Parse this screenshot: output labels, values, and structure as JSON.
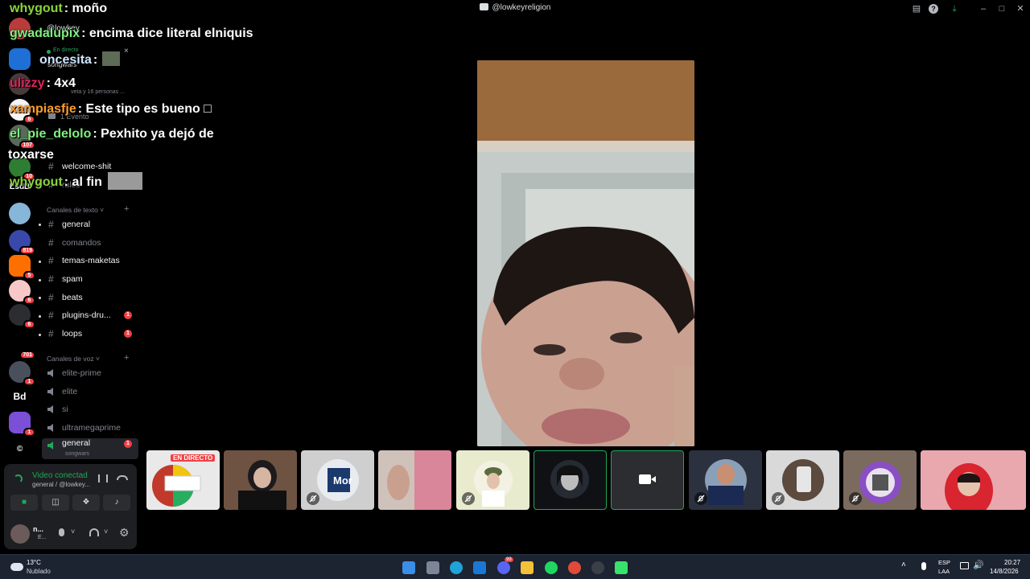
{
  "window": {
    "title": "@lowkeyreligion"
  },
  "server": {
    "name": "@lowkey",
    "live_label": "En directo",
    "live_channel": "songwars",
    "listeners_text": "veta y 16 personas ...",
    "event_label": "1 Evento"
  },
  "rail": {
    "servers": [
      {
        "badge": ""
      },
      {
        "badge": ""
      },
      {
        "badge": ""
      },
      {
        "badge": "6"
      },
      {
        "badge": "107"
      },
      {
        "badge": "10"
      },
      {
        "label": "EsdB",
        "badge": ""
      },
      {
        "badge": ""
      },
      {
        "badge": "819"
      },
      {
        "badge": "5"
      },
      {
        "badge": "6"
      },
      {
        "badge": "6"
      },
      {
        "badge": "701"
      },
      {
        "badge": "1"
      },
      {
        "label": "Bd",
        "badge": ""
      },
      {
        "badge": "1"
      },
      {
        "label": "©",
        "badge": ""
      }
    ]
  },
  "channels": {
    "top": [
      {
        "name": "welcome-shit"
      },
      {
        "name": "rules"
      }
    ],
    "text_category": "Canales de texto",
    "text": [
      {
        "name": "general",
        "badge": ""
      },
      {
        "name": "comandos",
        "badge": ""
      },
      {
        "name": "temas-maketas",
        "badge": ""
      },
      {
        "name": "spam",
        "badge": ""
      },
      {
        "name": "beats",
        "badge": ""
      },
      {
        "name": "plugins-dru...",
        "badge": "1"
      },
      {
        "name": "loops",
        "badge": "1"
      }
    ],
    "voice_category": "Canales de voz",
    "voice": [
      {
        "name": "elite-prime"
      },
      {
        "name": "elite"
      },
      {
        "name": "si"
      },
      {
        "name": "ultramegaprime"
      }
    ],
    "active_voice": {
      "name": "general",
      "sub": "songwars",
      "badge": "1"
    }
  },
  "chat": [
    {
      "user": "whygout",
      "color": "#8bd43b",
      "text": ": moño"
    },
    {
      "user": "gwadalupix",
      "color": "#7ff07f",
      "text": ": encima dice literal elniquis"
    },
    {
      "user": "oncesita",
      "color": "#cfe6ff",
      "text": ":"
    },
    {
      "user": "ulizzy",
      "color": "#e0245e",
      "text": ": 4x4"
    },
    {
      "user": "xampiasfje",
      "color": "#ff9e2c",
      "text": ": Este tipo es bueno □"
    },
    {
      "user": "el_pie_delolo",
      "color": "#7ff07f",
      "text": ": Pexhito ya dejó de"
    },
    {
      "user": "",
      "color": "#ffffff",
      "text": "toxarse"
    },
    {
      "user": "whygout",
      "color": "#8bd43b",
      "text": ": al fin"
    }
  ],
  "voice_panel": {
    "status": "Video conectad",
    "location": "general / @lowkey...",
    "username": "n...",
    "user_status": "E..."
  },
  "tiles": [
    {
      "live_label": "EN DIRECTO"
    },
    {
      "name": "tile-2"
    },
    {
      "name": "tile-3",
      "label": "Mor"
    }
  ],
  "taskbar": {
    "weather_temp": "13°C",
    "weather_text": "Nublado",
    "lang1": "ESP",
    "lang2": "LAA",
    "time": "20:27",
    "date": "14/8/2026",
    "discord_badge": "99"
  },
  "colors": {
    "accent_green": "#23a55a",
    "danger": "#f23f43",
    "bg": "#000000"
  }
}
